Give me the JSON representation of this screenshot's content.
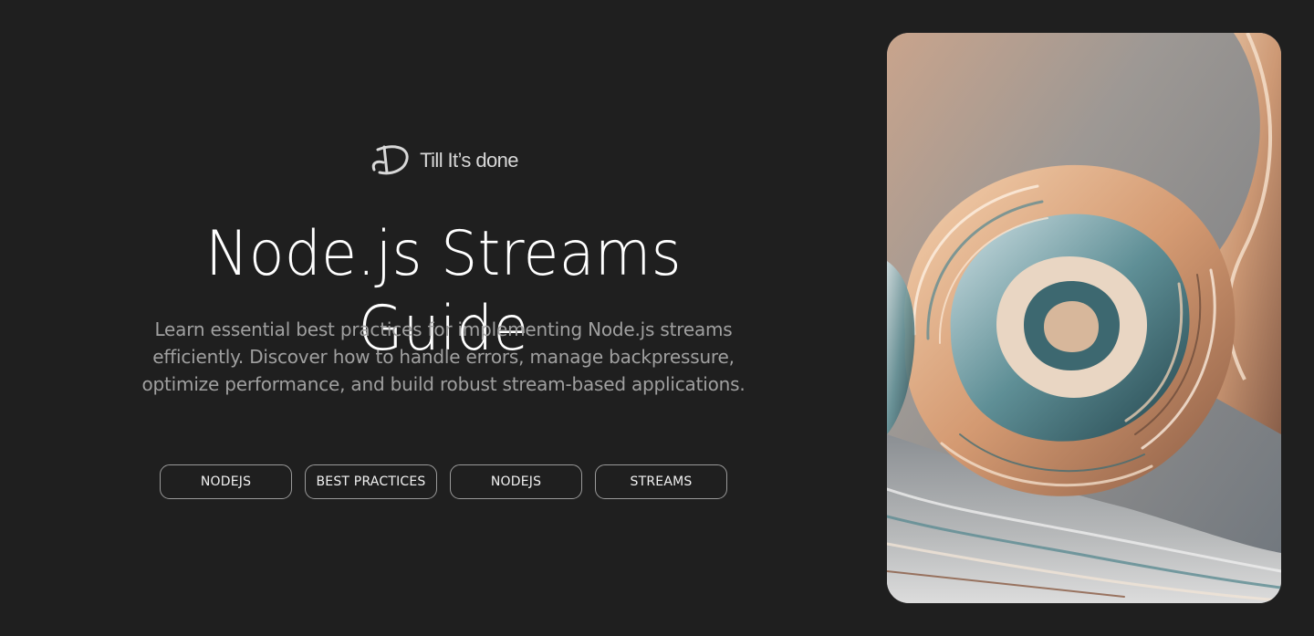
{
  "brand": {
    "name": "Till It’s done",
    "logo_icon": "td-monogram-icon"
  },
  "hero": {
    "title": "Node.js Streams Guide",
    "description": "Learn essential best practices for implementing Node.js streams efficiently. Discover how to handle errors, manage backpressure, optimize performance, and build robust stream-based applications.",
    "image_icon": "abstract-wave-artwork"
  },
  "tags": [
    {
      "label": "NODEJS"
    },
    {
      "label": "BEST PRACTICES"
    },
    {
      "label": "NODEJS"
    },
    {
      "label": "STREAMS"
    }
  ],
  "colors": {
    "background": "#1f1f1f",
    "title": "#ffffff",
    "description": "#a0a0a0",
    "tag_border": "#9a9a9a"
  }
}
